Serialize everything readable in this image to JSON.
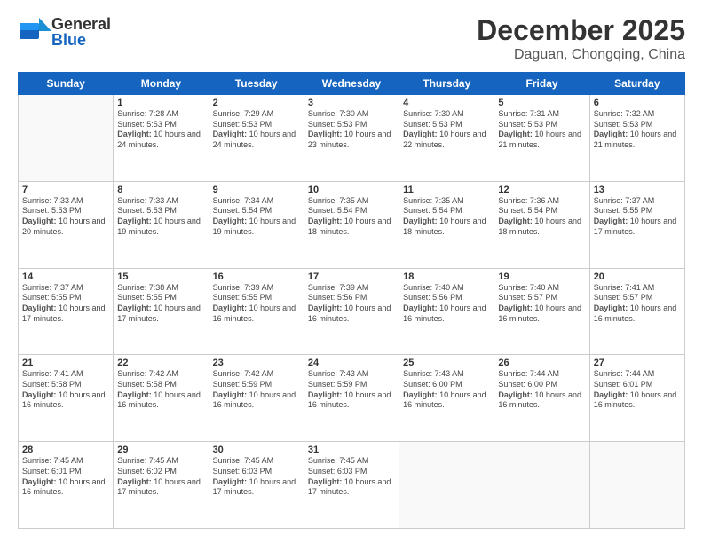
{
  "header": {
    "logo_general": "General",
    "logo_blue": "Blue",
    "month_title": "December 2025",
    "subtitle": "Daguan, Chongqing, China"
  },
  "weekdays": [
    "Sunday",
    "Monday",
    "Tuesday",
    "Wednesday",
    "Thursday",
    "Friday",
    "Saturday"
  ],
  "weeks": [
    [
      {
        "day": "",
        "empty": true
      },
      {
        "day": "1",
        "sunrise": "Sunrise: 7:28 AM",
        "sunset": "Sunset: 5:53 PM",
        "daylight": "Daylight: 10 hours and 24 minutes."
      },
      {
        "day": "2",
        "sunrise": "Sunrise: 7:29 AM",
        "sunset": "Sunset: 5:53 PM",
        "daylight": "Daylight: 10 hours and 24 minutes."
      },
      {
        "day": "3",
        "sunrise": "Sunrise: 7:30 AM",
        "sunset": "Sunset: 5:53 PM",
        "daylight": "Daylight: 10 hours and 23 minutes."
      },
      {
        "day": "4",
        "sunrise": "Sunrise: 7:30 AM",
        "sunset": "Sunset: 5:53 PM",
        "daylight": "Daylight: 10 hours and 22 minutes."
      },
      {
        "day": "5",
        "sunrise": "Sunrise: 7:31 AM",
        "sunset": "Sunset: 5:53 PM",
        "daylight": "Daylight: 10 hours and 21 minutes."
      },
      {
        "day": "6",
        "sunrise": "Sunrise: 7:32 AM",
        "sunset": "Sunset: 5:53 PM",
        "daylight": "Daylight: 10 hours and 21 minutes."
      }
    ],
    [
      {
        "day": "7",
        "sunrise": "Sunrise: 7:33 AM",
        "sunset": "Sunset: 5:53 PM",
        "daylight": "Daylight: 10 hours and 20 minutes."
      },
      {
        "day": "8",
        "sunrise": "Sunrise: 7:33 AM",
        "sunset": "Sunset: 5:53 PM",
        "daylight": "Daylight: 10 hours and 19 minutes."
      },
      {
        "day": "9",
        "sunrise": "Sunrise: 7:34 AM",
        "sunset": "Sunset: 5:54 PM",
        "daylight": "Daylight: 10 hours and 19 minutes."
      },
      {
        "day": "10",
        "sunrise": "Sunrise: 7:35 AM",
        "sunset": "Sunset: 5:54 PM",
        "daylight": "Daylight: 10 hours and 18 minutes."
      },
      {
        "day": "11",
        "sunrise": "Sunrise: 7:35 AM",
        "sunset": "Sunset: 5:54 PM",
        "daylight": "Daylight: 10 hours and 18 minutes."
      },
      {
        "day": "12",
        "sunrise": "Sunrise: 7:36 AM",
        "sunset": "Sunset: 5:54 PM",
        "daylight": "Daylight: 10 hours and 18 minutes."
      },
      {
        "day": "13",
        "sunrise": "Sunrise: 7:37 AM",
        "sunset": "Sunset: 5:55 PM",
        "daylight": "Daylight: 10 hours and 17 minutes."
      }
    ],
    [
      {
        "day": "14",
        "sunrise": "Sunrise: 7:37 AM",
        "sunset": "Sunset: 5:55 PM",
        "daylight": "Daylight: 10 hours and 17 minutes."
      },
      {
        "day": "15",
        "sunrise": "Sunrise: 7:38 AM",
        "sunset": "Sunset: 5:55 PM",
        "daylight": "Daylight: 10 hours and 17 minutes."
      },
      {
        "day": "16",
        "sunrise": "Sunrise: 7:39 AM",
        "sunset": "Sunset: 5:55 PM",
        "daylight": "Daylight: 10 hours and 16 minutes."
      },
      {
        "day": "17",
        "sunrise": "Sunrise: 7:39 AM",
        "sunset": "Sunset: 5:56 PM",
        "daylight": "Daylight: 10 hours and 16 minutes."
      },
      {
        "day": "18",
        "sunrise": "Sunrise: 7:40 AM",
        "sunset": "Sunset: 5:56 PM",
        "daylight": "Daylight: 10 hours and 16 minutes."
      },
      {
        "day": "19",
        "sunrise": "Sunrise: 7:40 AM",
        "sunset": "Sunset: 5:57 PM",
        "daylight": "Daylight: 10 hours and 16 minutes."
      },
      {
        "day": "20",
        "sunrise": "Sunrise: 7:41 AM",
        "sunset": "Sunset: 5:57 PM",
        "daylight": "Daylight: 10 hours and 16 minutes."
      }
    ],
    [
      {
        "day": "21",
        "sunrise": "Sunrise: 7:41 AM",
        "sunset": "Sunset: 5:58 PM",
        "daylight": "Daylight: 10 hours and 16 minutes."
      },
      {
        "day": "22",
        "sunrise": "Sunrise: 7:42 AM",
        "sunset": "Sunset: 5:58 PM",
        "daylight": "Daylight: 10 hours and 16 minutes."
      },
      {
        "day": "23",
        "sunrise": "Sunrise: 7:42 AM",
        "sunset": "Sunset: 5:59 PM",
        "daylight": "Daylight: 10 hours and 16 minutes."
      },
      {
        "day": "24",
        "sunrise": "Sunrise: 7:43 AM",
        "sunset": "Sunset: 5:59 PM",
        "daylight": "Daylight: 10 hours and 16 minutes."
      },
      {
        "day": "25",
        "sunrise": "Sunrise: 7:43 AM",
        "sunset": "Sunset: 6:00 PM",
        "daylight": "Daylight: 10 hours and 16 minutes."
      },
      {
        "day": "26",
        "sunrise": "Sunrise: 7:44 AM",
        "sunset": "Sunset: 6:00 PM",
        "daylight": "Daylight: 10 hours and 16 minutes."
      },
      {
        "day": "27",
        "sunrise": "Sunrise: 7:44 AM",
        "sunset": "Sunset: 6:01 PM",
        "daylight": "Daylight: 10 hours and 16 minutes."
      }
    ],
    [
      {
        "day": "28",
        "sunrise": "Sunrise: 7:45 AM",
        "sunset": "Sunset: 6:01 PM",
        "daylight": "Daylight: 10 hours and 16 minutes."
      },
      {
        "day": "29",
        "sunrise": "Sunrise: 7:45 AM",
        "sunset": "Sunset: 6:02 PM",
        "daylight": "Daylight: 10 hours and 17 minutes."
      },
      {
        "day": "30",
        "sunrise": "Sunrise: 7:45 AM",
        "sunset": "Sunset: 6:03 PM",
        "daylight": "Daylight: 10 hours and 17 minutes."
      },
      {
        "day": "31",
        "sunrise": "Sunrise: 7:45 AM",
        "sunset": "Sunset: 6:03 PM",
        "daylight": "Daylight: 10 hours and 17 minutes."
      },
      {
        "day": "",
        "empty": true
      },
      {
        "day": "",
        "empty": true
      },
      {
        "day": "",
        "empty": true
      }
    ]
  ]
}
